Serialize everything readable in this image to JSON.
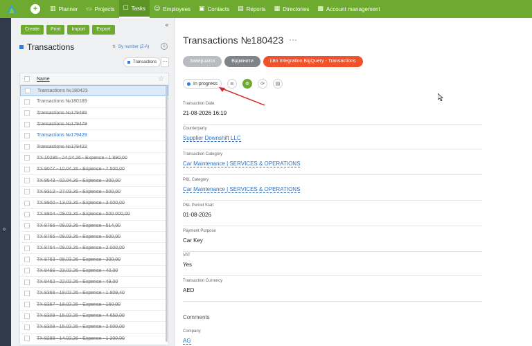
{
  "nav": {
    "items": [
      {
        "icon": "▥",
        "label": "Planner",
        "active": false
      },
      {
        "icon": "▭",
        "label": "Projects",
        "active": false
      },
      {
        "icon": "☐",
        "label": "Tasks",
        "active": true
      },
      {
        "icon": "☺",
        "label": "Employees",
        "active": false
      },
      {
        "icon": "▣",
        "label": "Contacts",
        "active": false
      },
      {
        "icon": "▤",
        "label": "Reports",
        "active": false
      },
      {
        "icon": "▦",
        "label": "Directories",
        "active": false
      },
      {
        "icon": "▩",
        "label": "Account management",
        "active": false
      }
    ]
  },
  "list": {
    "buttons": [
      "Create",
      "Print",
      "Import",
      "Export"
    ],
    "title": "Transactions",
    "sort_label": "By number (Z-A)",
    "chip_label": "Transactions",
    "column_name": "Name",
    "rows": [
      {
        "label": "Transactions №180423",
        "style": "selected"
      },
      {
        "label": "Transactions №180189",
        "style": "plain"
      },
      {
        "label": "Transactions №179485",
        "style": "strike"
      },
      {
        "label": "Transactions №179479",
        "style": "strike"
      },
      {
        "label": "Transactions №179429",
        "style": "blue"
      },
      {
        "label": "Transactions №179422",
        "style": "strike"
      },
      {
        "label": "TX 10295 - 24.04.26 - Expense - 1 890,00",
        "style": "strike"
      },
      {
        "label": "TX 9077 - 10.04.26 - Expense - 7 500,00",
        "style": "strike"
      },
      {
        "label": "TX 9543 - 02.04.26 - Expense - 300,00",
        "style": "strike"
      },
      {
        "label": "TX 9312 - 27.03.26 - Expense - 500,00",
        "style": "strike"
      },
      {
        "label": "TX 8900 - 13.03.26 - Expense - 3 000,00",
        "style": "strike"
      },
      {
        "label": "TX 8804 - 09.03.26 - Expense - 500 000,00",
        "style": "strike"
      },
      {
        "label": "TX 8766 - 08.03.26 - Expense - 514,00",
        "style": "strike"
      },
      {
        "label": "TX 8765 - 08.03.26 - Expense - 500,00",
        "style": "strike"
      },
      {
        "label": "TX 8764 - 08.03.26 - Expense - 2 000,00",
        "style": "strike"
      },
      {
        "label": "TX 8763 - 08.03.26 - Expense - 300,00",
        "style": "strike"
      },
      {
        "label": "TX 8488 - 23.02.26 - Expense - 40,00",
        "style": "strike"
      },
      {
        "label": "TX 8462 - 22.02.26 - Expense - 49,00",
        "style": "strike"
      },
      {
        "label": "TX 8368 - 18.02.26 - Expense - 1 809,40",
        "style": "strike"
      },
      {
        "label": "TX 8367 - 18.02.26 - Expense - 160,00",
        "style": "strike"
      },
      {
        "label": "TX 8309 - 15.02.26 - Expense - 4 650,00",
        "style": "strike"
      },
      {
        "label": "TX 8308 - 15.02.26 - Expense - 2 000,00",
        "style": "strike"
      },
      {
        "label": "TX 8299 - 14.02.26 - Expense - 1 200,00",
        "style": "strike"
      }
    ]
  },
  "detail": {
    "title": "Transactions №180423",
    "more": "···",
    "actions": [
      {
        "label": "Завершити",
        "style": "grey"
      },
      {
        "label": "Відмінити",
        "style": "dgrey"
      },
      {
        "label": "n8n Integration BigQuery - Transactions",
        "style": "red"
      }
    ],
    "status": "In progress",
    "fields": [
      {
        "label": "Transaction Date",
        "value": "21-08-2026 16:19",
        "link": false
      },
      {
        "label": "Counterparty",
        "value": "Supplier Downshift LLC",
        "link": true
      },
      {
        "label": "Transaction Category",
        "value": "Car Maintenance | SERVICES & OPERATIONS",
        "link": true
      },
      {
        "label": "P&L Category",
        "value": "Car Maintenance | SERVICES & OPERATIONS",
        "link": true
      },
      {
        "label": "P&L Period Start",
        "value": "01-08-2026",
        "link": false
      },
      {
        "label": "Payment Purpose",
        "value": "Car Key",
        "link": false
      },
      {
        "label": "VAT",
        "value": "Yes",
        "link": false
      },
      {
        "label": "Transaction Currency",
        "value": "AED",
        "link": false
      }
    ],
    "comments_label": "Comments",
    "company_label": "Company",
    "company_value": "AG"
  },
  "colors": {
    "brand": "#6eaa2f",
    "accent": "#2a7de1",
    "danger": "#f0522c"
  }
}
